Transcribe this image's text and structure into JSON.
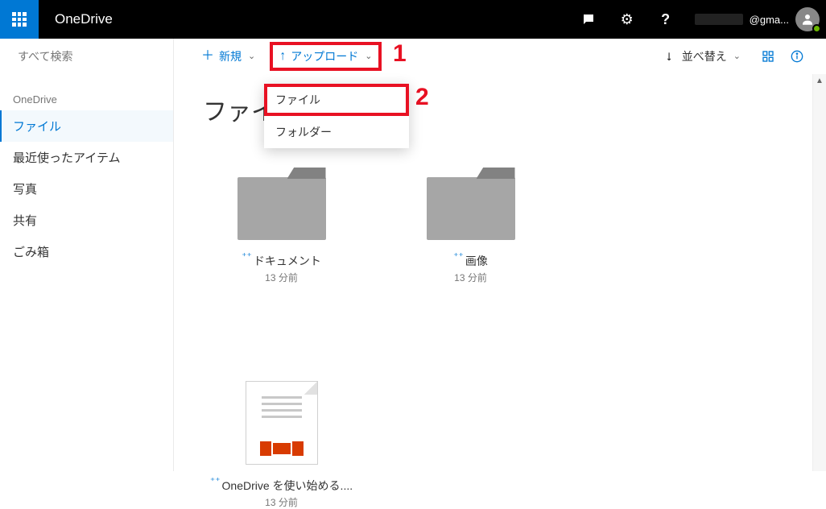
{
  "header": {
    "brand": "OneDrive",
    "account_email_suffix": "@gma..."
  },
  "search": {
    "placeholder": "すべて検索"
  },
  "nav": {
    "root_label": "OneDrive",
    "items": [
      {
        "label": "ファイル",
        "active": true
      },
      {
        "label": "最近使ったアイテム",
        "active": false
      },
      {
        "label": "写真",
        "active": false
      },
      {
        "label": "共有",
        "active": false
      },
      {
        "label": "ごみ箱",
        "active": false
      }
    ]
  },
  "commands": {
    "new_label": "新規",
    "upload_label": "アップロード",
    "sort_label": "並べ替え"
  },
  "upload_menu": {
    "file": "ファイル",
    "folder": "フォルダー"
  },
  "callouts": {
    "one": "1",
    "two": "2"
  },
  "page": {
    "title": "ファイル"
  },
  "items": [
    {
      "kind": "folder",
      "name": "ドキュメント",
      "time": "13 分前"
    },
    {
      "kind": "folder",
      "name": "画像",
      "time": "13 分前"
    },
    {
      "kind": "doc",
      "name": "OneDrive を使い始める....",
      "time": "13 分前"
    }
  ]
}
